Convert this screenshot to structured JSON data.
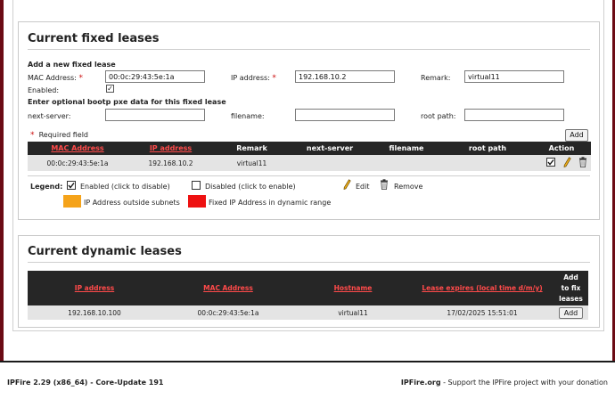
{
  "fixed_leases": {
    "title": "Current fixed leases",
    "add_heading": "Add a new fixed lease",
    "mac_label": "MAC Address:",
    "mac_value": "00:0c:29:43:5e:1a",
    "ip_label": "IP address:",
    "ip_value": "192.168.10.2",
    "remark_label": "Remark:",
    "remark_value": "virtual11",
    "enabled_label": "Enabled:",
    "enabled_checked": "✓",
    "pxe_heading": "Enter optional bootp pxe data for this fixed lease",
    "next_server_label": "next-server:",
    "filename_label": "filename:",
    "root_path_label": "root path:",
    "required_star": "*",
    "required_label": "Required field",
    "add_button": "Add",
    "columns": [
      "MAC Address",
      "IP address",
      "Remark",
      "next-server",
      "filename",
      "root path",
      "Action"
    ],
    "rows": [
      {
        "mac": "00:0c:29:43:5e:1a",
        "ip": "192.168.10.2",
        "remark": "virtual11",
        "next_server": "",
        "filename": "",
        "root_path": ""
      }
    ],
    "legend": {
      "label": "Legend:",
      "enabled": "Enabled (click to disable)",
      "disabled": "Disabled (click to enable)",
      "edit": "Edit",
      "remove": "Remove",
      "outside_subnets": "IP Address outside subnets",
      "in_dynamic_range": "Fixed IP Address in dynamic range",
      "outside_color": "#f5a31a",
      "dynamic_color": "#ee1111"
    }
  },
  "dynamic_leases": {
    "title": "Current dynamic leases",
    "columns": [
      "IP address",
      "MAC Address",
      "Hostname",
      "Lease expires (local time d/m/y)",
      "Add to fix leases"
    ],
    "add_col_lines": [
      "Add",
      "to fix",
      "leases"
    ],
    "rows": [
      {
        "ip": "192.168.10.100",
        "mac": "00:0c:29:43:5e:1a",
        "hostname": "virtual11",
        "expires": "17/02/2025 15:51:01",
        "action": "Add"
      }
    ]
  },
  "footer": {
    "version": "IPFire 2.29 (x86_64) - Core-Update 191",
    "site": "IPFire.org",
    "tagline": " - Support the IPFire project with your donation"
  },
  "colors": {
    "accent_red": "#ff4a4a",
    "dark_header": "#262626",
    "frame": "#6b0a14"
  }
}
